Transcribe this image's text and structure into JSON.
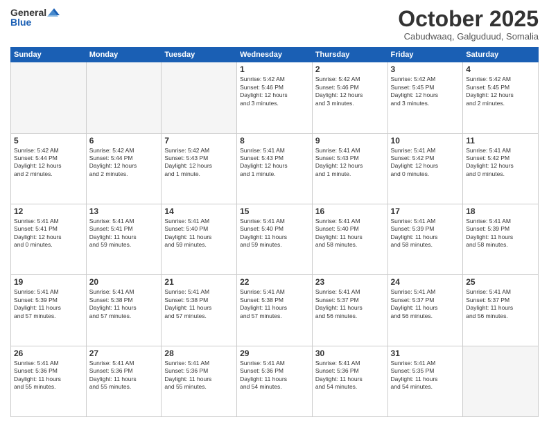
{
  "header": {
    "logo_general": "General",
    "logo_blue": "Blue",
    "month_title": "October 2025",
    "location": "Cabudwaaq, Galguduud, Somalia"
  },
  "days_of_week": [
    "Sunday",
    "Monday",
    "Tuesday",
    "Wednesday",
    "Thursday",
    "Friday",
    "Saturday"
  ],
  "weeks": [
    [
      {
        "day": "",
        "info": ""
      },
      {
        "day": "",
        "info": ""
      },
      {
        "day": "",
        "info": ""
      },
      {
        "day": "1",
        "info": "Sunrise: 5:42 AM\nSunset: 5:46 PM\nDaylight: 12 hours\nand 3 minutes."
      },
      {
        "day": "2",
        "info": "Sunrise: 5:42 AM\nSunset: 5:46 PM\nDaylight: 12 hours\nand 3 minutes."
      },
      {
        "day": "3",
        "info": "Sunrise: 5:42 AM\nSunset: 5:45 PM\nDaylight: 12 hours\nand 3 minutes."
      },
      {
        "day": "4",
        "info": "Sunrise: 5:42 AM\nSunset: 5:45 PM\nDaylight: 12 hours\nand 2 minutes."
      }
    ],
    [
      {
        "day": "5",
        "info": "Sunrise: 5:42 AM\nSunset: 5:44 PM\nDaylight: 12 hours\nand 2 minutes."
      },
      {
        "day": "6",
        "info": "Sunrise: 5:42 AM\nSunset: 5:44 PM\nDaylight: 12 hours\nand 2 minutes."
      },
      {
        "day": "7",
        "info": "Sunrise: 5:42 AM\nSunset: 5:43 PM\nDaylight: 12 hours\nand 1 minute."
      },
      {
        "day": "8",
        "info": "Sunrise: 5:41 AM\nSunset: 5:43 PM\nDaylight: 12 hours\nand 1 minute."
      },
      {
        "day": "9",
        "info": "Sunrise: 5:41 AM\nSunset: 5:43 PM\nDaylight: 12 hours\nand 1 minute."
      },
      {
        "day": "10",
        "info": "Sunrise: 5:41 AM\nSunset: 5:42 PM\nDaylight: 12 hours\nand 0 minutes."
      },
      {
        "day": "11",
        "info": "Sunrise: 5:41 AM\nSunset: 5:42 PM\nDaylight: 12 hours\nand 0 minutes."
      }
    ],
    [
      {
        "day": "12",
        "info": "Sunrise: 5:41 AM\nSunset: 5:41 PM\nDaylight: 12 hours\nand 0 minutes."
      },
      {
        "day": "13",
        "info": "Sunrise: 5:41 AM\nSunset: 5:41 PM\nDaylight: 11 hours\nand 59 minutes."
      },
      {
        "day": "14",
        "info": "Sunrise: 5:41 AM\nSunset: 5:40 PM\nDaylight: 11 hours\nand 59 minutes."
      },
      {
        "day": "15",
        "info": "Sunrise: 5:41 AM\nSunset: 5:40 PM\nDaylight: 11 hours\nand 59 minutes."
      },
      {
        "day": "16",
        "info": "Sunrise: 5:41 AM\nSunset: 5:40 PM\nDaylight: 11 hours\nand 58 minutes."
      },
      {
        "day": "17",
        "info": "Sunrise: 5:41 AM\nSunset: 5:39 PM\nDaylight: 11 hours\nand 58 minutes."
      },
      {
        "day": "18",
        "info": "Sunrise: 5:41 AM\nSunset: 5:39 PM\nDaylight: 11 hours\nand 58 minutes."
      }
    ],
    [
      {
        "day": "19",
        "info": "Sunrise: 5:41 AM\nSunset: 5:39 PM\nDaylight: 11 hours\nand 57 minutes."
      },
      {
        "day": "20",
        "info": "Sunrise: 5:41 AM\nSunset: 5:38 PM\nDaylight: 11 hours\nand 57 minutes."
      },
      {
        "day": "21",
        "info": "Sunrise: 5:41 AM\nSunset: 5:38 PM\nDaylight: 11 hours\nand 57 minutes."
      },
      {
        "day": "22",
        "info": "Sunrise: 5:41 AM\nSunset: 5:38 PM\nDaylight: 11 hours\nand 57 minutes."
      },
      {
        "day": "23",
        "info": "Sunrise: 5:41 AM\nSunset: 5:37 PM\nDaylight: 11 hours\nand 56 minutes."
      },
      {
        "day": "24",
        "info": "Sunrise: 5:41 AM\nSunset: 5:37 PM\nDaylight: 11 hours\nand 56 minutes."
      },
      {
        "day": "25",
        "info": "Sunrise: 5:41 AM\nSunset: 5:37 PM\nDaylight: 11 hours\nand 56 minutes."
      }
    ],
    [
      {
        "day": "26",
        "info": "Sunrise: 5:41 AM\nSunset: 5:36 PM\nDaylight: 11 hours\nand 55 minutes."
      },
      {
        "day": "27",
        "info": "Sunrise: 5:41 AM\nSunset: 5:36 PM\nDaylight: 11 hours\nand 55 minutes."
      },
      {
        "day": "28",
        "info": "Sunrise: 5:41 AM\nSunset: 5:36 PM\nDaylight: 11 hours\nand 55 minutes."
      },
      {
        "day": "29",
        "info": "Sunrise: 5:41 AM\nSunset: 5:36 PM\nDaylight: 11 hours\nand 54 minutes."
      },
      {
        "day": "30",
        "info": "Sunrise: 5:41 AM\nSunset: 5:36 PM\nDaylight: 11 hours\nand 54 minutes."
      },
      {
        "day": "31",
        "info": "Sunrise: 5:41 AM\nSunset: 5:35 PM\nDaylight: 11 hours\nand 54 minutes."
      },
      {
        "day": "",
        "info": ""
      }
    ]
  ]
}
